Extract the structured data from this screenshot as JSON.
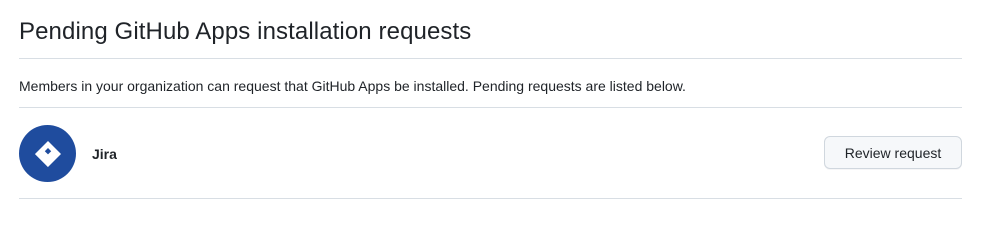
{
  "header": {
    "title": "Pending GitHub Apps installation requests"
  },
  "description": "Members in your organization can request that GitHub Apps be installed. Pending requests are listed below.",
  "requests": [
    {
      "app_name": "Jira",
      "icon": "jira-logo-icon",
      "avatar_color": "#1f4c9e",
      "action_label": "Review request"
    }
  ],
  "colors": {
    "divider": "#d8dee4",
    "button_bg": "#f6f8fa",
    "button_border": "#d0d7de",
    "text": "#1f2328"
  }
}
